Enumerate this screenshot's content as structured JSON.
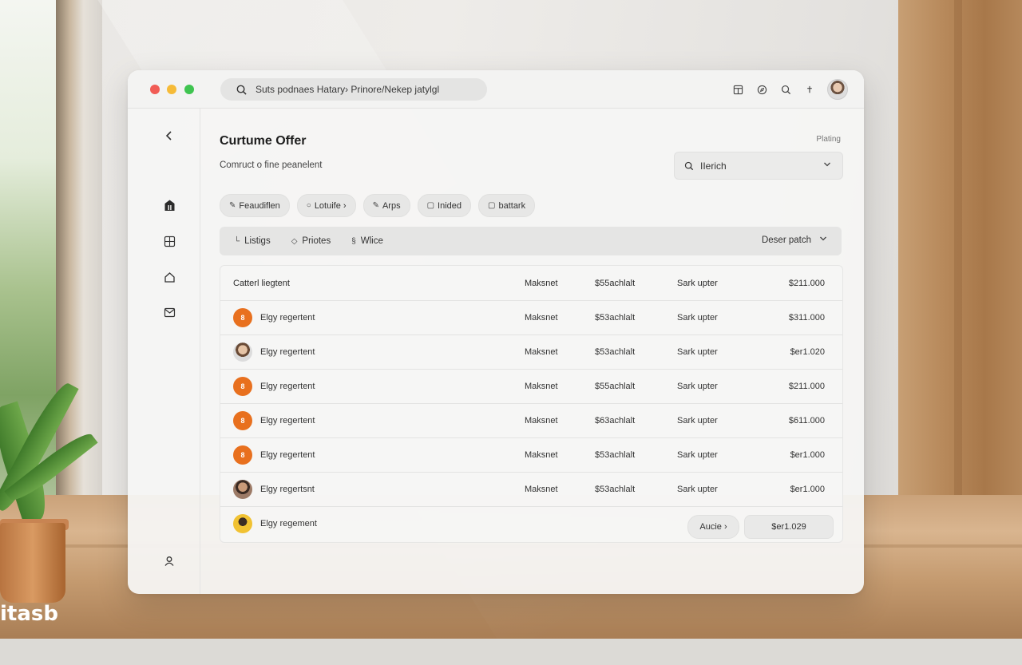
{
  "window": {
    "address": "Suts podnaes Hatary› Prinore/Nekep jatylgl"
  },
  "toolbar_icons": [
    "panel-icon",
    "compass-icon",
    "search-icon",
    "share-icon"
  ],
  "sidebar": {
    "items": [
      "back-icon",
      "home-icon",
      "grid-icon",
      "house-icon",
      "mail-icon",
      "account-icon"
    ]
  },
  "page": {
    "title": "Curtume Offer",
    "subtitle": "Comruct o fine peanelent",
    "top_right_label": "Plating"
  },
  "filter": {
    "value": "IIerich"
  },
  "chips": [
    {
      "label": "Feaudiflen",
      "icon": "✎"
    },
    {
      "label": "Lotuife ›",
      "icon": "○"
    },
    {
      "label": "Arps",
      "icon": "✎"
    },
    {
      "label": "Inided",
      "icon": "▢"
    },
    {
      "label": "battark",
      "icon": "▢"
    }
  ],
  "tabs": [
    {
      "label": "Listigs",
      "icon": "└"
    },
    {
      "label": "Priotes",
      "icon": "◇"
    },
    {
      "label": "Wlice",
      "icon": "§"
    }
  ],
  "sort": {
    "label": "Deser patch"
  },
  "table": {
    "header": {
      "name": "Catterl liegtent",
      "type": "Maksnet",
      "price": "$55achlalt",
      "status": "Sark upter",
      "amount": "$211.000"
    },
    "rows": [
      {
        "name": "Elgy regertent",
        "type": "Maksnet",
        "price": "$53achlalt",
        "status": "Sark upter",
        "amount": "$311.000",
        "avatar": "orange",
        "initial": "8"
      },
      {
        "name": "Elgy regertent",
        "type": "Maksnet",
        "price": "$53achlalt",
        "status": "Sark upter",
        "amount": "$er1.020",
        "avatar": "person",
        "initial": ""
      },
      {
        "name": "Elgy regertent",
        "type": "Maksnet",
        "price": "$55achlalt",
        "status": "Sark upter",
        "amount": "$211.000",
        "avatar": "orange",
        "initial": "8"
      },
      {
        "name": "Elgy regertent",
        "type": "Maksnet",
        "price": "$63achlalt",
        "status": "Sark upter",
        "amount": "$611.000",
        "avatar": "orange",
        "initial": "8"
      },
      {
        "name": "Elgy regertent",
        "type": "Maksnet",
        "price": "$53achlalt",
        "status": "Sark upter",
        "amount": "$er1.000",
        "avatar": "orange",
        "initial": "8"
      },
      {
        "name": "Elgy regertsnt",
        "type": "Maksnet",
        "price": "$53achlalt",
        "status": "Sark upter",
        "amount": "$er1.000",
        "avatar": "person-dark",
        "initial": ""
      },
      {
        "name": "Elgy regement",
        "type": "",
        "price": "",
        "status": "",
        "amount": "",
        "avatar": "yellow",
        "initial": ""
      }
    ]
  },
  "footer": {
    "more_label": "Aucie ›",
    "total": "$er1.029"
  },
  "watermark": "itasb",
  "colors": {
    "accent_orange": "#e8701e",
    "traffic_red": "#f15c55",
    "traffic_yellow": "#f6bb38",
    "traffic_green": "#3fc450"
  }
}
